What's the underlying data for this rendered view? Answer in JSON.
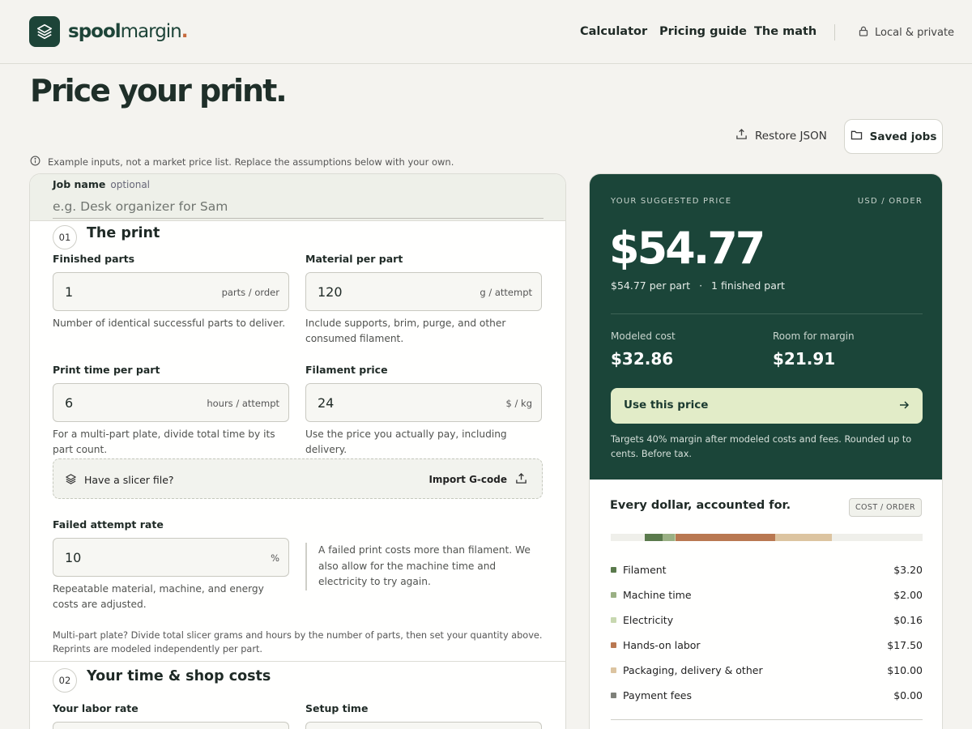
{
  "brand": {
    "name_bold": "spool",
    "name_light": "margin",
    "dot": "."
  },
  "nav": {
    "calculator": "Calculator",
    "pricing_guide": "Pricing guide",
    "the_math": "The math",
    "privacy": "Local & private"
  },
  "page_title": "Price your print.",
  "toolbar": {
    "restore": "Restore JSON",
    "saved": "Saved jobs"
  },
  "disclaimer": "Example inputs, not a market price list. Replace the assumptions below with your own.",
  "job": {
    "label": "Job name",
    "optional": "optional",
    "placeholder": "e.g. Desk organizer for Sam"
  },
  "section1": {
    "num": "01",
    "title": "The print",
    "finished_parts": {
      "label": "Finished parts",
      "value": "1",
      "unit": "parts / order",
      "help": "Number of identical successful parts to deliver."
    },
    "material": {
      "label": "Material per part",
      "value": "120",
      "unit": "g / attempt",
      "help": "Include supports, brim, purge, and other consumed filament."
    },
    "print_time": {
      "label": "Print time per part",
      "value": "6",
      "unit": "hours / attempt",
      "help": "For a multi-part plate, divide total time by its part count."
    },
    "filament_price": {
      "label": "Filament price",
      "value": "24",
      "unit": "$ / kg",
      "help": "Use the price you actually pay, including delivery."
    },
    "slicer": {
      "text": "Have a slicer file?",
      "import": "Import G-code"
    },
    "fail_rate": {
      "label": "Failed attempt rate",
      "value": "10",
      "unit": "%",
      "help": "Repeatable material, machine, and energy costs are adjusted.",
      "note": "A failed print costs more than filament. We also allow for the machine time and electricity to try again."
    },
    "multi_note": "Multi-part plate? Divide total slicer grams and hours by the number of parts, then set your quantity above. Reprints are modeled independently per part."
  },
  "section2": {
    "num": "02",
    "title": "Your time & shop costs",
    "labor_label": "Your labor rate",
    "setup_label": "Setup time"
  },
  "summary": {
    "suggested_label": "YOUR SUGGESTED PRICE",
    "currency_label": "USD / ORDER",
    "price": "$54.77",
    "per_part": "$54.77 per part",
    "sep": "·",
    "finished": "1 finished part",
    "modeled_cost_label": "Modeled cost",
    "modeled_cost": "$32.86",
    "margin_label": "Room for margin",
    "margin": "$21.91",
    "use_price": "Use this price",
    "targets": "Targets 40% margin after modeled costs and fees. Rounded up to cents. Before tax."
  },
  "breakdown": {
    "title": "Every dollar, accounted for.",
    "badge": "COST / ORDER",
    "items": [
      {
        "name": "Filament",
        "amount": "$3.20",
        "value": 3.2,
        "color": "#5a7a4c"
      },
      {
        "name": "Machine time",
        "amount": "$2.00",
        "value": 2.0,
        "color": "#9ab084"
      },
      {
        "name": "Electricity",
        "amount": "$0.16",
        "value": 0.16,
        "color": "#c8d8b0"
      },
      {
        "name": "Hands-on labor",
        "amount": "$17.50",
        "value": 17.5,
        "color": "#b97851"
      },
      {
        "name": "Packaging, delivery & other",
        "amount": "$10.00",
        "value": 10.0,
        "color": "#dcc4a0"
      },
      {
        "name": "Payment fees",
        "amount": "$0.00",
        "value": 0.0,
        "color": "#7e8079"
      }
    ],
    "bar_total": 54.77
  }
}
